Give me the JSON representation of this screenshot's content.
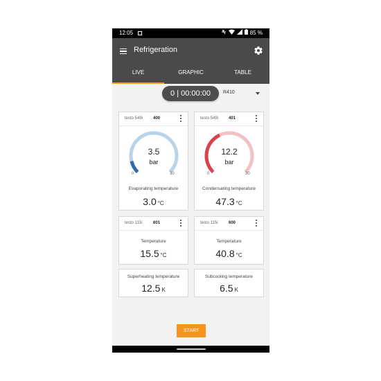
{
  "status_bar": {
    "time": "12:05",
    "battery": "85 %"
  },
  "app_bar": {
    "title": "Refrigeration"
  },
  "tabs": [
    {
      "label": "LIVE",
      "active": true
    },
    {
      "label": "GRAPHIC",
      "active": false
    },
    {
      "label": "TABLE",
      "active": false
    }
  ],
  "toolbar": {
    "timer": "0 | 00:00:00",
    "refrigerant": "R410"
  },
  "pressure_cards": [
    {
      "model": "testo 549i",
      "serial": "400",
      "gauge_value": "3.5",
      "gauge_unit": "bar",
      "gauge_min": "0",
      "gauge_max": "30",
      "gauge_fraction": 0.117,
      "gauge_color": "#2f6aa3",
      "gauge_track": "#b9d3e8",
      "label": "Evaporating temperature",
      "value": "3.0",
      "unit": "°C"
    },
    {
      "model": "testo 549i",
      "serial": "401",
      "gauge_value": "12.2",
      "gauge_unit": "bar",
      "gauge_min": "0",
      "gauge_max": "30",
      "gauge_fraction": 0.407,
      "gauge_color": "#d9434b",
      "gauge_track": "#f2c1c5",
      "label": "Condensating temperature",
      "value": "47.3",
      "unit": "°C"
    }
  ],
  "temp_cards": [
    {
      "model": "testo 115i",
      "serial": "601",
      "label": "Temperature",
      "value": "15.5",
      "unit": "°C"
    },
    {
      "model": "testo 115i",
      "serial": "600",
      "label": "Temperature",
      "value": "40.8",
      "unit": "°C"
    }
  ],
  "calc_cards": [
    {
      "label": "Superheating temperature",
      "value": "12.5",
      "unit": "K"
    },
    {
      "label": "Subcooling temperature",
      "value": "6.5",
      "unit": "K"
    }
  ],
  "start_button": {
    "label": "START"
  },
  "colors": {
    "accent": "#f7931e",
    "header": "#4a4a4a"
  }
}
